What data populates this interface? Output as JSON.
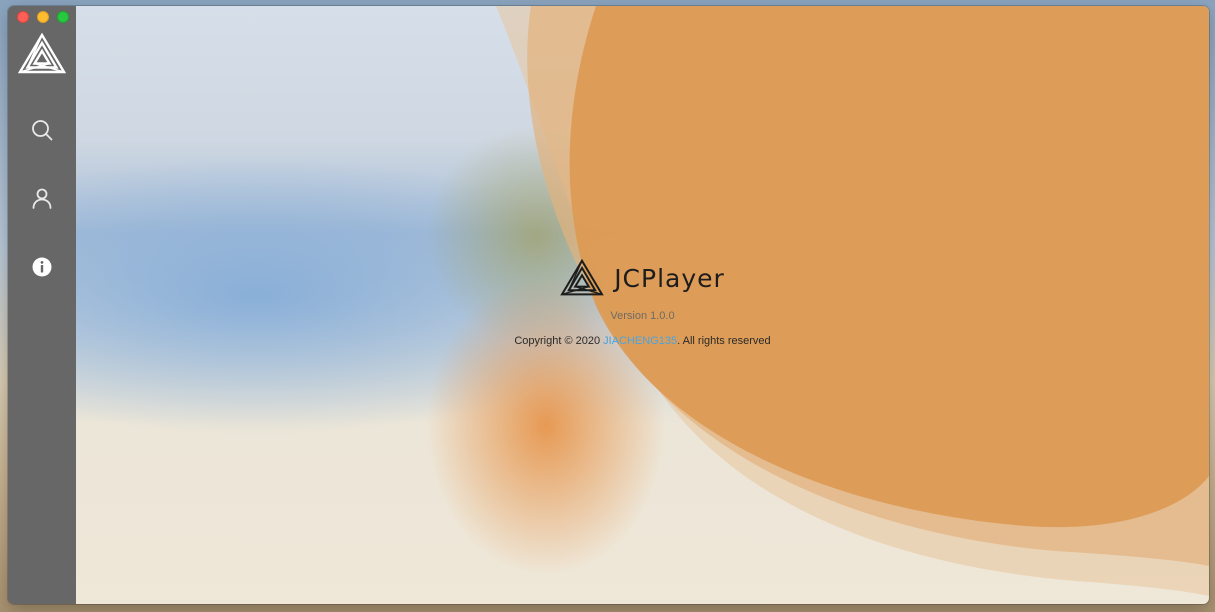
{
  "window": {
    "controls": [
      "close",
      "minimize",
      "maximize"
    ]
  },
  "sidebar": {
    "logo_icon": "jcplayer-logo-icon",
    "items": [
      {
        "icon": "search-icon",
        "name": "search"
      },
      {
        "icon": "user-icon",
        "name": "account"
      },
      {
        "icon": "info-icon",
        "name": "about",
        "active": true
      }
    ]
  },
  "about": {
    "app_name": "JCPlayer",
    "version": "Version 1.0.0",
    "copyright_prefix": "Copyright © 2020 ",
    "author_link": "JIACHENG135",
    "copyright_suffix": ". All rights reserved"
  },
  "colors": {
    "sidebar": "#676767",
    "accent_orange": "#dc9a54",
    "link": "#4aa3df"
  }
}
